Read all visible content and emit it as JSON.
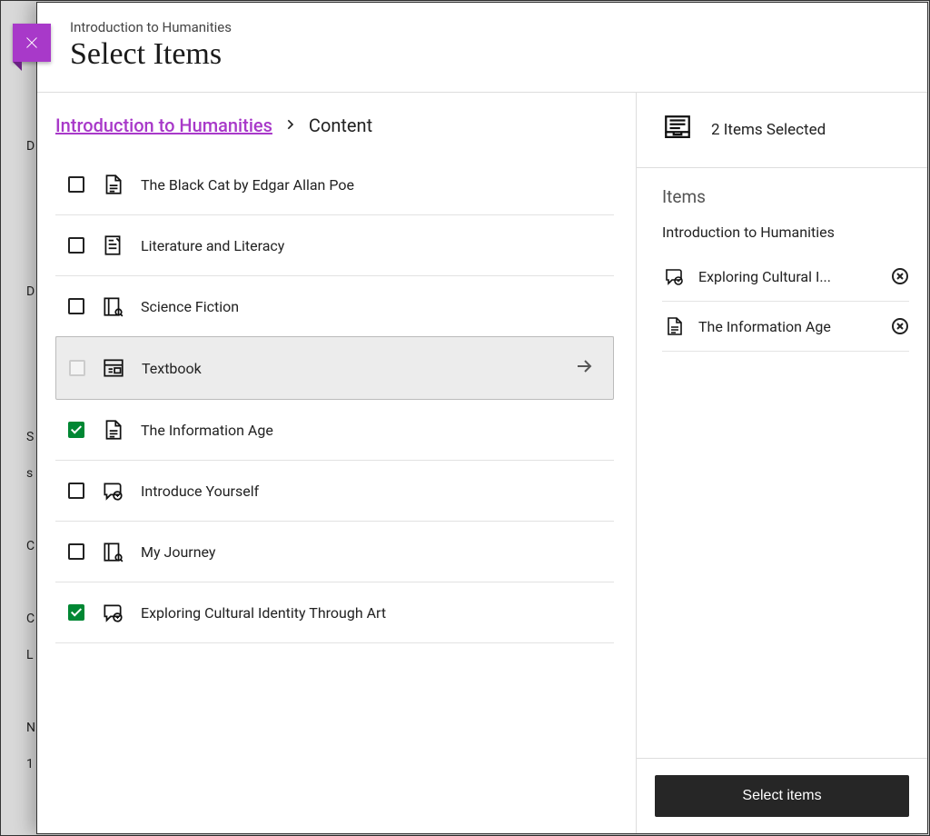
{
  "header": {
    "subtitle": "Introduction to Humanities",
    "title": "Select Items"
  },
  "breadcrumb": {
    "root": "Introduction to Humanities",
    "current": "Content"
  },
  "items": [
    {
      "label": "The Black Cat by Edgar Allan Poe",
      "icon": "doc",
      "checked": false,
      "folder": false
    },
    {
      "label": "Literature and Literacy",
      "icon": "assignment",
      "checked": false,
      "folder": false
    },
    {
      "label": "Science Fiction",
      "icon": "journal",
      "checked": false,
      "folder": false
    },
    {
      "label": "Textbook",
      "icon": "module",
      "checked": false,
      "folder": true
    },
    {
      "label": "The Information Age",
      "icon": "doc",
      "checked": true,
      "folder": false
    },
    {
      "label": "Introduce Yourself",
      "icon": "discussion",
      "checked": false,
      "folder": false
    },
    {
      "label": "My Journey",
      "icon": "journal",
      "checked": false,
      "folder": false
    },
    {
      "label": "Exploring Cultural Identity Through Art",
      "icon": "discussion",
      "checked": true,
      "folder": false
    }
  ],
  "selection": {
    "count_text": "2 Items Selected",
    "section_title": "Items",
    "context": "Introduction to Humanities",
    "selected": [
      {
        "label": "Exploring Cultural I...",
        "icon": "discussion"
      },
      {
        "label": "The Information Age",
        "icon": "doc"
      }
    ]
  },
  "footer": {
    "button": "Select items"
  }
}
